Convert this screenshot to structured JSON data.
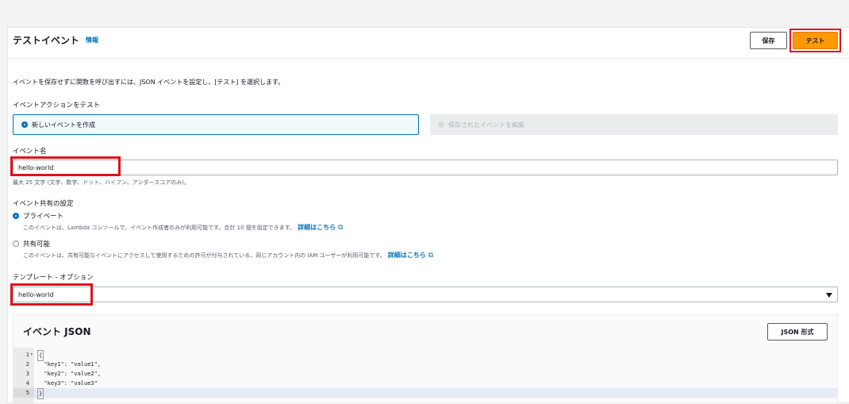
{
  "header": {
    "title": "テストイベント",
    "info_link": "情報",
    "save_label": "保存",
    "test_label": "テスト"
  },
  "description": "イベントを保存せずに関数を呼び出すには、JSON イベントを設定し、[テスト] を選択します。",
  "event_action": {
    "label": "イベントアクションをテスト",
    "options": [
      {
        "label": "新しいイベントを作成",
        "selected": true
      },
      {
        "label": "保存されたイベントを編集",
        "selected": false,
        "disabled": true
      }
    ]
  },
  "event_name": {
    "label": "イベント名",
    "value": "hello-world",
    "hint": "最大 25 文字 (文字、数字、ドット、ハイフン、アンダースコアのみ)。"
  },
  "sharing": {
    "label": "イベント共有の設定",
    "options": [
      {
        "label": "プライベート",
        "selected": true,
        "description": "このイベントは、Lambda コンソールで、イベント作成者のみが利用可能です。合計 10 個を設定できます。",
        "link": "詳細はこちら"
      },
      {
        "label": "共有可能",
        "selected": false,
        "description": "このイベントは、共有可能なイベントにアクセスして使用するための許可が付与されている、同じアカウント内の IAM ユーザーが利用可能です。",
        "link": "詳細はこちら"
      }
    ]
  },
  "template": {
    "label": "テンプレート - オプション",
    "value": "hello-world"
  },
  "event_json": {
    "title": "イベント JSON",
    "format_label": "JSON 形式",
    "lines": [
      {
        "n": "1",
        "text": "{"
      },
      {
        "n": "2",
        "text": "  \"key1\": \"value1\","
      },
      {
        "n": "3",
        "text": "  \"key2\": \"value2\","
      },
      {
        "n": "4",
        "text": "  \"key3\": \"value3\""
      },
      {
        "n": "5",
        "text": "}"
      }
    ]
  },
  "colors": {
    "accent": "#0073bb",
    "primary_button": "#ff9900",
    "annotation_box": "#e0121b"
  }
}
